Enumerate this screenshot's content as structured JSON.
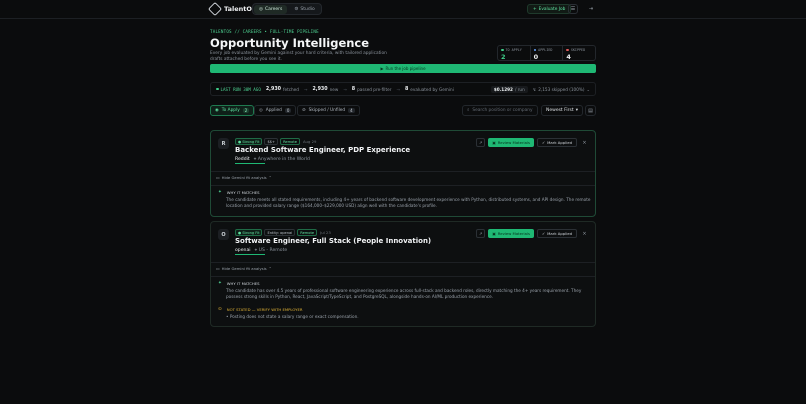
{
  "app": {
    "name": "TalentOS"
  },
  "nav": {
    "items": [
      {
        "label": "Careers",
        "active": true
      },
      {
        "label": "Studio",
        "active": false
      }
    ]
  },
  "topbar": {
    "evaluate_label": "Evaluate Job"
  },
  "header": {
    "eyebrow": "TALENTOS // CAREERS  •  FULL-TIME PIPELINE",
    "title": "Opportunity Intelligence",
    "subtitle": "Every job evaluated by Gemini against your hard criteria, with tailored application drafts attached before you see it."
  },
  "stats": [
    {
      "label": "TO APPLY",
      "value": "2",
      "color": "#3fcf8a"
    },
    {
      "label": "APPLIED",
      "value": "0",
      "color": "#6aa6ff"
    },
    {
      "label": "SKIPPED",
      "value": "4",
      "color": "#e05a5a"
    }
  ],
  "run_button": {
    "label": "Run the job pipeline"
  },
  "pipeline": {
    "last_run": "LAST RUN 30M AGO",
    "fetched_count": "2,930",
    "fetched_label": "fetched",
    "new_count": "2,930",
    "new_label": "new",
    "filter_count": "8",
    "filter_label": "passed pre-filter",
    "eval_count": "8",
    "eval_label": "evaluated by Gemini",
    "cost_value": "$0.1292",
    "cost_unit": "/ run",
    "skipped_summary": "2,153 skipped (100%)"
  },
  "filters": {
    "tabs": [
      {
        "label": "To Apply",
        "count": "2",
        "active": true
      },
      {
        "label": "Applied",
        "count": "0",
        "active": false
      },
      {
        "label": "Skipped / Unfiled",
        "count": "4",
        "active": false
      }
    ],
    "search_placeholder": "Search position or company",
    "sort_value": "Newest First"
  },
  "jobs": [
    {
      "avatar": "R",
      "tags": [
        "Strong Fit",
        "$$+",
        "Remote"
      ],
      "date": "Aug 29",
      "title": "Backend Software Engineer, PDP Experience",
      "company": "Reddit",
      "location": "Anywhere in the World",
      "review_label": "Review Materials",
      "mark_label": "Mark Applied",
      "toggle_label": "Hide Gemini fit analysis",
      "why_heading": "WHY IT MATCHES",
      "why_text": "The candidate meets all stated requirements, including 4+ years of backend software development experience with Python, distributed systems, and API design. The remote location and provided salary range ($164,000–$229,000 USD) align well with the candidate's profile."
    },
    {
      "avatar": "O",
      "tags": [
        "Strong Fit",
        "Entity: openai",
        "Remote"
      ],
      "date": "Jul 23",
      "title": "Software Engineer, Full Stack (People Innovation)",
      "company": "openai",
      "location": "US - Remote",
      "review_label": "Review Materials",
      "mark_label": "Mark Applied",
      "toggle_label": "Hide Gemini fit analysis",
      "why_heading": "WHY IT MATCHES",
      "why_text": "The candidate has over 4.5 years of professional software engineering experience across full-stack and backend roles, directly matching the 4+ years requirement. They possess strong skills in Python, React, JavaScript/TypeScript, and PostgreSQL, alongside hands-on AI/ML production experience.",
      "warn_heading": "NOT STATED — VERIFY WITH EMPLOYER",
      "warn_text": "Posting does not state a salary range or exact compensation."
    }
  ]
}
